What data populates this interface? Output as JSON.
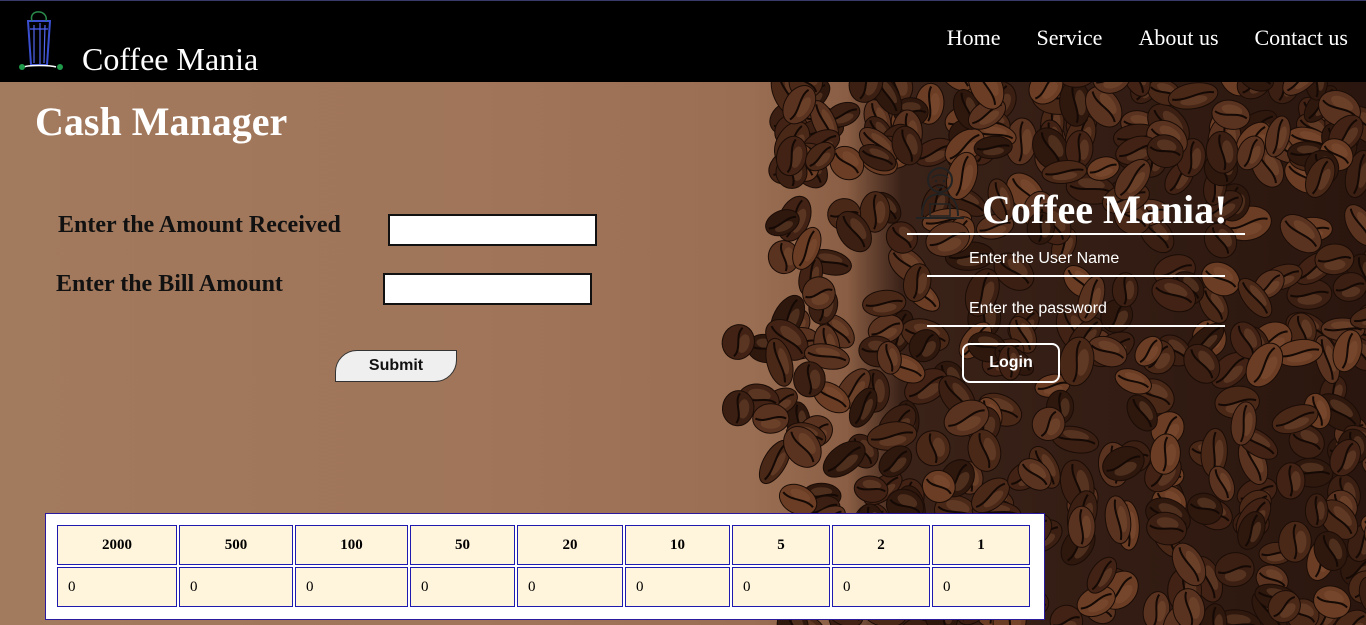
{
  "navbar": {
    "brand": "Coffee Mania",
    "links": [
      "Home",
      "Service",
      "About us",
      "Contact us"
    ]
  },
  "cash_manager": {
    "title": "Cash Manager",
    "amount_received_label": "Enter the Amount Received",
    "amount_received_value": "",
    "bill_amount_label": "Enter the Bill Amount",
    "bill_amount_value": "",
    "submit_label": "Submit"
  },
  "login": {
    "title": "Coffee Mania!",
    "username_placeholder": "Enter the User Name",
    "password_placeholder": "Enter the password",
    "login_label": "Login"
  },
  "denominations": {
    "headers": [
      "2000",
      "500",
      "100",
      "50",
      "20",
      "10",
      "5",
      "2",
      "1"
    ],
    "counts": [
      "0",
      "0",
      "0",
      "0",
      "0",
      "0",
      "0",
      "0",
      "0"
    ]
  },
  "icons": {
    "logo": "coffee-glass-logo-icon",
    "login": "barista-icon"
  },
  "colors": {
    "navbar": "#000000",
    "table_cell": "#fff5dc",
    "table_border": "#1e1ab0"
  }
}
